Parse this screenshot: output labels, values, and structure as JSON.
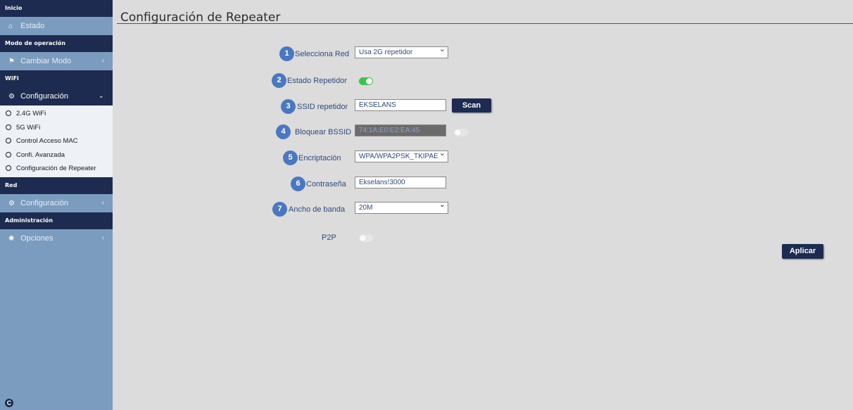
{
  "sidebar": {
    "sections": {
      "inicio": "Inicio",
      "modo": "Modo de operación",
      "wifi": "WiFi",
      "red": "Red",
      "admin": "Administración"
    },
    "items": {
      "estado": "Estado",
      "cambiar_modo": "Cambiar Modo",
      "wifi_config": "Configuración",
      "red_config": "Configuración",
      "opciones": "Opciones"
    },
    "wifi_sub": [
      "2.4G WiFi",
      "5G WiFi",
      "Control Acceso MAC",
      "Confi. Avanzada",
      "Configuración de Repeater"
    ],
    "bottom_icon": "C"
  },
  "page": {
    "title": "Configuración de Repeater"
  },
  "form": {
    "red": {
      "badge": "1",
      "label": "Selecciona Red",
      "value": "Usa 2G repetidor"
    },
    "estado": {
      "badge": "2",
      "label": "Estado Repetidor",
      "enabled": true
    },
    "ssid": {
      "badge": "3",
      "label": "SSID repetidor",
      "value": "EKSELANS",
      "scan_label": "Scan"
    },
    "bssid": {
      "badge": "4",
      "label": "Bloquear BSSID",
      "value": "74:1A:E0:E2:EA:45",
      "locked": false
    },
    "enc": {
      "badge": "5",
      "label": "Encriptación",
      "value": "WPA/WPA2PSK_TKIPAE"
    },
    "pass": {
      "badge": "6",
      "label": "Contraseña",
      "value": "Ekselans!3000"
    },
    "bw": {
      "badge": "7",
      "label": "Ancho de banda",
      "value": "20M"
    },
    "p2p": {
      "label": "P2P",
      "enabled": false
    }
  },
  "actions": {
    "apply_label": "Aplicar"
  },
  "colors": {
    "sidebar_bg": "#7b9cbf",
    "header_dark": "#1c2b4f",
    "badge_blue": "#4a78c0",
    "toggle_on": "#3cc44a",
    "page_bg": "#dcdcdc"
  }
}
